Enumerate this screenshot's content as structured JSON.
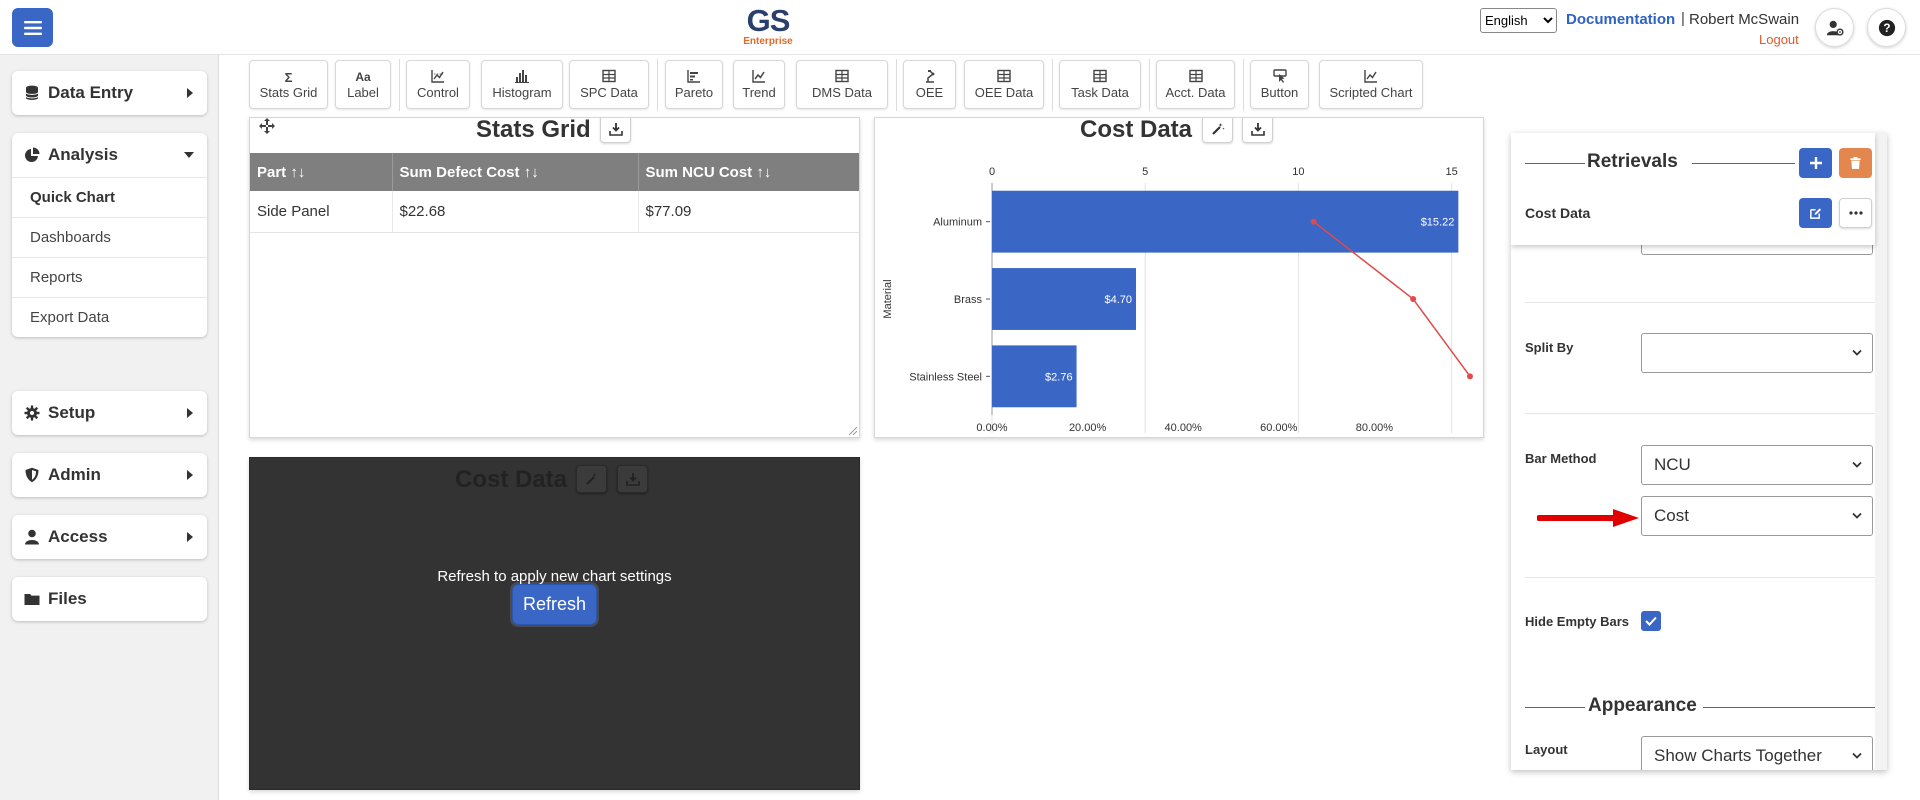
{
  "header": {
    "logo_main": "GS",
    "logo_sub": "Enterprise",
    "language": "English",
    "documentation": "Documentation",
    "separator": "|",
    "user": "Robert McSwain",
    "logout": "Logout"
  },
  "sidebar": {
    "data_entry": "Data Entry",
    "analysis": "Analysis",
    "analysis_items": [
      "Quick Chart",
      "Dashboards",
      "Reports",
      "Export Data"
    ],
    "setup": "Setup",
    "admin": "Admin",
    "access": "Access",
    "files": "Files"
  },
  "toolbar": {
    "items": [
      "Stats Grid",
      "Label",
      "Control",
      "Histogram",
      "SPC Data",
      "Pareto",
      "Trend",
      "DMS Data",
      "OEE",
      "OEE Data",
      "Task Data",
      "Acct. Data",
      "Button",
      "Scripted Chart"
    ],
    "sigma": "Σ",
    "aa": "Aa"
  },
  "stats_grid": {
    "title": "Stats Grid",
    "headers": [
      "Part",
      "Sum Defect Cost",
      "Sum NCU Cost"
    ],
    "sort_glyph": "↑↓",
    "rows": [
      [
        "Side Panel",
        "$22.68",
        "$77.09"
      ]
    ]
  },
  "cost_chart": {
    "title": "Cost Data"
  },
  "chart_data": {
    "type": "bar",
    "orientation": "horizontal",
    "categories": [
      "Aluminum",
      "Brass",
      "Stainless Steel"
    ],
    "values": [
      15.22,
      4.7,
      2.76
    ],
    "data_labels": [
      "$15.22",
      "$4.70",
      "$2.76"
    ],
    "ylabel": "Material",
    "xlim": [
      0,
      15.6
    ],
    "x_ticks": [
      "0",
      "5",
      "10",
      "15"
    ],
    "secondary_axis_ticks": [
      "0.00%",
      "20.00%",
      "40.00%",
      "60.00%",
      "80.00%"
    ],
    "cumulative_percent": [
      67.3,
      88.1,
      100.0
    ],
    "secondary_xlim": [
      0,
      100
    ],
    "grid": true,
    "bar_color": "#3a66c5",
    "line_color": "#e24a4a"
  },
  "cost_chart_2": {
    "title": "Cost Data",
    "message": "Refresh to apply new chart settings",
    "refresh": "Refresh"
  },
  "settings": {
    "retrievals_title": "Retrievals",
    "retrieval_name": "Cost Data",
    "split_by_label": "Split By",
    "split_by_value": "",
    "bar_method_label": "Bar Method",
    "bar_method_value_1": "NCU",
    "bar_method_value_2": "Cost",
    "hide_empty_label": "Hide Empty Bars",
    "hide_empty_checked": true,
    "appearance_title": "Appearance",
    "layout_label": "Layout",
    "layout_value": "Show Charts Together"
  },
  "colors": {
    "accent": "#3a66c5",
    "danger": "#e4874f",
    "logout": "#e05a2a",
    "annotation_arrow": "#e00000"
  }
}
